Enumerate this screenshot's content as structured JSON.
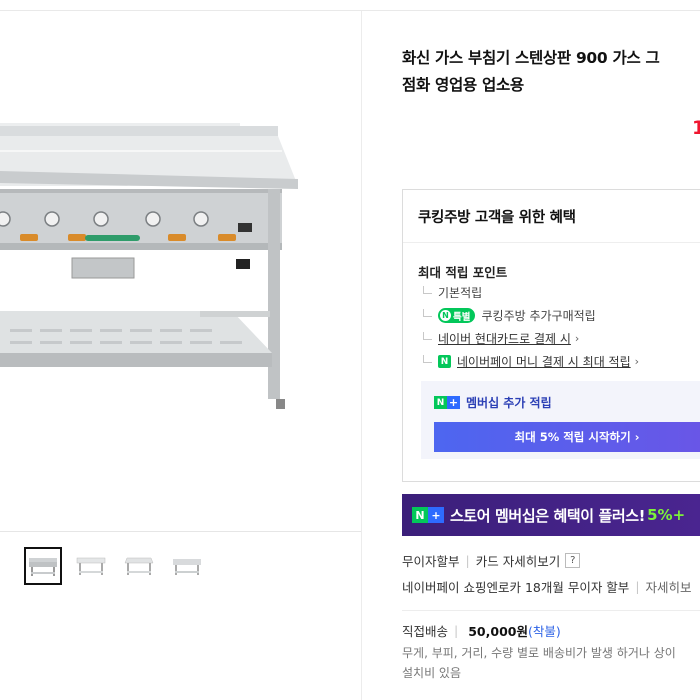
{
  "product": {
    "title_line1": "화신 가스 부침기 스텐상판 900 가스 그",
    "title_line2": "점화 영업용 업소용",
    "price_fragment": "1"
  },
  "gallery": {
    "thumbnails": [
      "thumbnail-1",
      "thumbnail-2",
      "thumbnail-3",
      "thumbnail-4"
    ],
    "active_index": 0
  },
  "benefits": {
    "heading": "쿠킹주방 고객을 위한 혜택",
    "points_title": "최대 적립 포인트",
    "items": [
      {
        "label": "기본적립"
      },
      {
        "badge": "특별",
        "label": "쿠킹주방 추가구매적립"
      },
      {
        "label": "네이버 현대카드로 결제 시",
        "chevron": "›"
      },
      {
        "icon": "N",
        "label": "네이버페이 머니 결제 시 최대 적립",
        "chevron": "›"
      }
    ],
    "membership_label": "멤버십 추가 적립",
    "membership_button": "최대 5% 적립 시작하기 ›"
  },
  "banner": {
    "text": "스토어 멤버십은 혜택이 플러스!",
    "highlight": "5%+"
  },
  "installment": {
    "label": "무이자할부",
    "card_link": "카드 자세히보기",
    "help": "?",
    "detail": "네이버페이 쇼핑엔로카 18개월 무이자 할부",
    "detail_link": "자세히보"
  },
  "shipping": {
    "label": "직접배송",
    "price": "50,000원",
    "type": "(착불)",
    "note": "무게, 부피, 거리, 수량 별로 배송비가 발생 하거나 상이",
    "note2": "설치비 있음"
  },
  "icons": {
    "npay": "N",
    "plus": "+"
  },
  "colors": {
    "accent_green": "#03c75a",
    "price_red": "#f0162f",
    "membership_blue": "#2b3fb5",
    "banner_purple": "#3b1f7a",
    "banner_highlight": "#7cf23a"
  }
}
